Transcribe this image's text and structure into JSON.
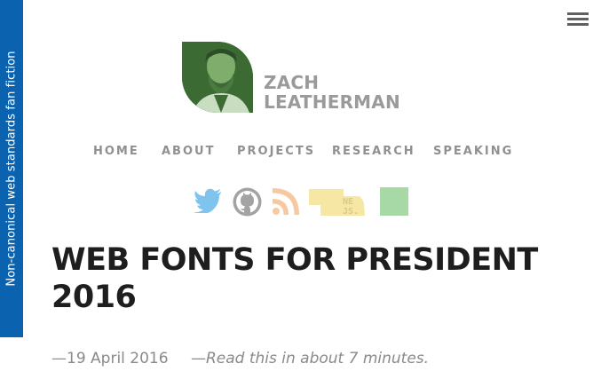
{
  "sidebar": {
    "tagline": "Non-canonical web standards fan fiction"
  },
  "header": {
    "menu_icon": "hamburger-menu-icon",
    "logo": {
      "first_name": "ZACH",
      "last_name": "LEATHERMAN",
      "avatar_color": "#3b6a33",
      "text_color": "#9a9a9a"
    }
  },
  "nav": {
    "items": [
      {
        "label": "HOME"
      },
      {
        "label": "ABOUT"
      },
      {
        "label": "PROJECTS"
      },
      {
        "label": "RESEARCH"
      },
      {
        "label": "SPEAKING"
      }
    ]
  },
  "social": {
    "items": [
      {
        "icon": "twitter-icon",
        "color": "#7fc4ee"
      },
      {
        "icon": "github-icon",
        "color": "#a3a3a3"
      },
      {
        "icon": "rss-icon",
        "color": "#f7c9a0"
      },
      {
        "icon": "nebraska-js-icon",
        "color": "#f6e8a4",
        "label": "NE JS"
      },
      {
        "icon": "green-square-icon",
        "color": "#a6d9a6"
      }
    ]
  },
  "post": {
    "title": "WEB FONTS FOR PRESIDENT 2016",
    "date": "—19 April 2016",
    "read_time": "—Read this in about 7 minutes."
  }
}
